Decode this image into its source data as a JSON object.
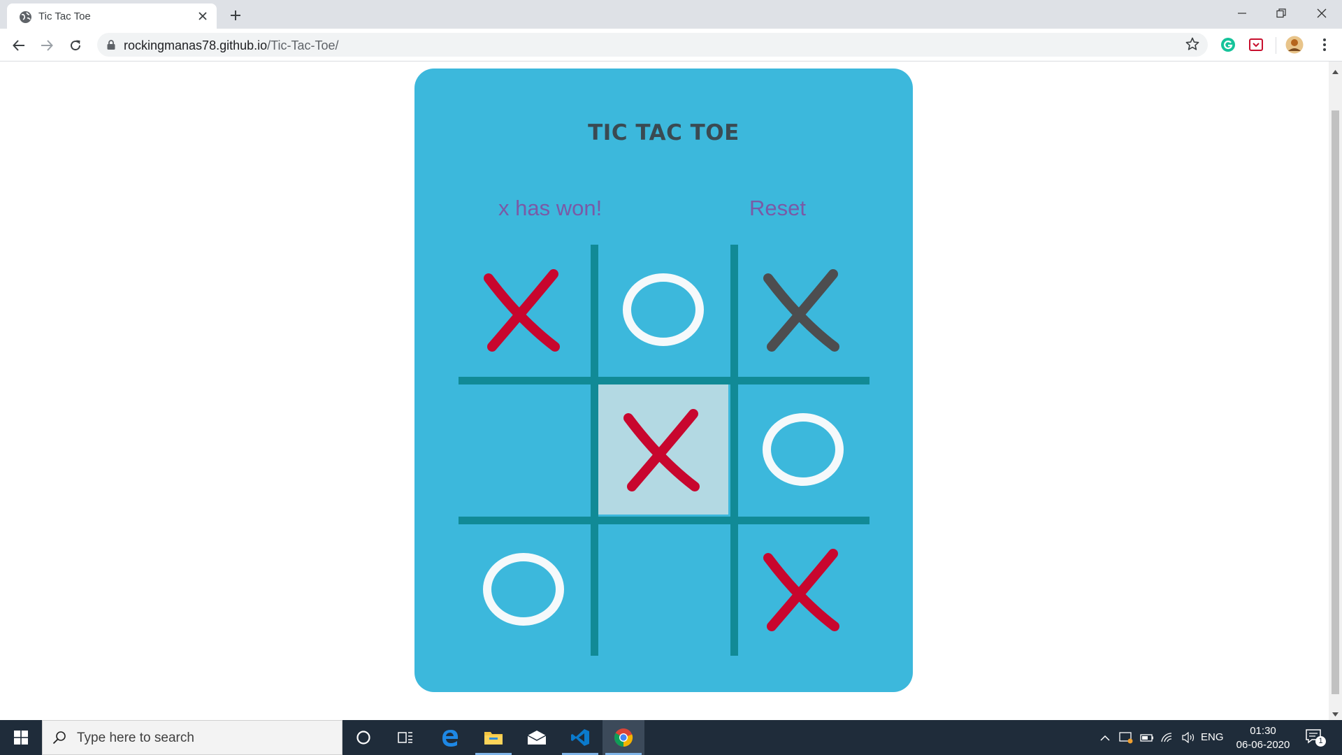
{
  "browser": {
    "tab_title": "Tic Tac Toe",
    "url_host": "rockingmanas78.github.io",
    "url_path": "/Tic-Tac-Toe/"
  },
  "game": {
    "title": "TIC TAC TOE",
    "status": "x has won!",
    "reset_label": "Reset",
    "board": [
      [
        "X",
        "O",
        "X"
      ],
      [
        "",
        "X",
        "O"
      ],
      [
        "O",
        "",
        "X"
      ]
    ],
    "highlighted_cell": [
      1,
      1
    ],
    "colors": {
      "card": "#3cb8dc",
      "grid": "#118a96",
      "x_mark": "#c8062e",
      "x_mark_dim": "#4d4d4f",
      "o_mark": "#f5f9fb",
      "highlight": "#b3d9e3",
      "status_text": "#7a5aa6"
    }
  },
  "taskbar": {
    "search_placeholder": "Type here to search",
    "language": "ENG",
    "time": "01:30",
    "date": "06-06-2020",
    "notification_count": "1"
  }
}
